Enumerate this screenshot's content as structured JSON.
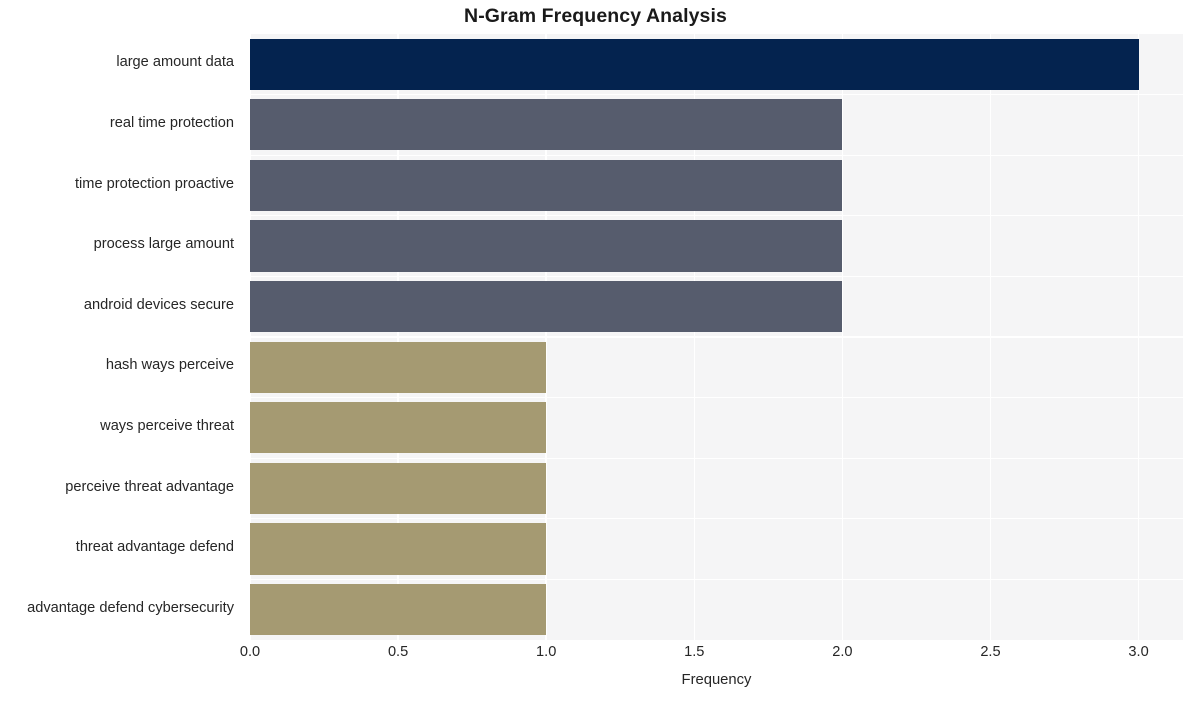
{
  "chart_data": {
    "type": "bar",
    "orientation": "horizontal",
    "title": "N-Gram Frequency Analysis",
    "xlabel": "Frequency",
    "ylabel": "",
    "categories": [
      "large amount data",
      "real time protection",
      "time protection proactive",
      "process large amount",
      "android devices secure",
      "hash ways perceive",
      "ways perceive threat",
      "perceive threat advantage",
      "threat advantage defend",
      "advantage defend cybersecurity"
    ],
    "values": [
      3,
      2,
      2,
      2,
      2,
      1,
      1,
      1,
      1,
      1
    ],
    "bar_colors": [
      "#04234f",
      "#565c6d",
      "#565c6d",
      "#565c6d",
      "#565c6d",
      "#a59a72",
      "#a59a72",
      "#a59a72",
      "#a59a72",
      "#a59a72"
    ],
    "xlim": [
      0,
      3.15
    ],
    "xticks": [
      "0.0",
      "0.5",
      "1.0",
      "1.5",
      "2.0",
      "2.5",
      "3.0"
    ],
    "xtick_values": [
      0,
      0.5,
      1,
      1.5,
      2,
      2.5,
      3
    ],
    "grid": true,
    "grid_color": "#ffffff",
    "plot_background": "#f5f5f6",
    "figure_background": "#ffffff",
    "legend": null
  }
}
